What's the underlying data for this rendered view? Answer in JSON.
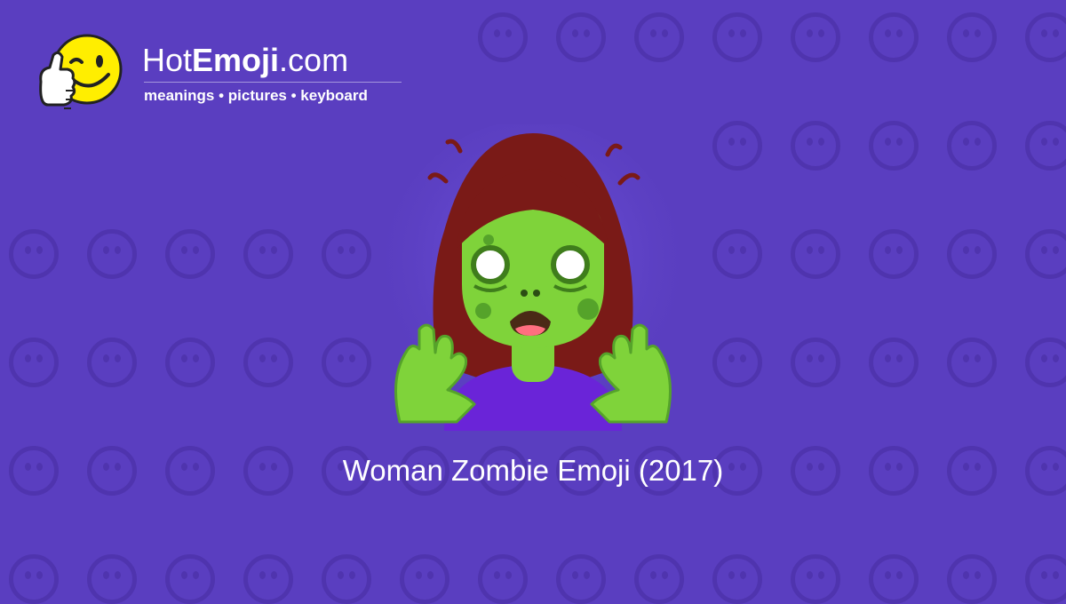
{
  "site": {
    "name_prefix": "Hot",
    "name_bold": "Emoji",
    "name_suffix": ".com",
    "tagline": "meanings • pictures • keyboard"
  },
  "caption": "Woman Zombie Emoji (2017)",
  "colors": {
    "background": "#5a3ec0",
    "skin": "#7fd33a",
    "hair": "#7a1a17",
    "shirt": "#6a24d8",
    "logo_face": "#ffee00"
  },
  "icons": {
    "mascot": "thumbs-up-winking-face-icon",
    "hero": "woman-zombie-emoji-icon"
  }
}
